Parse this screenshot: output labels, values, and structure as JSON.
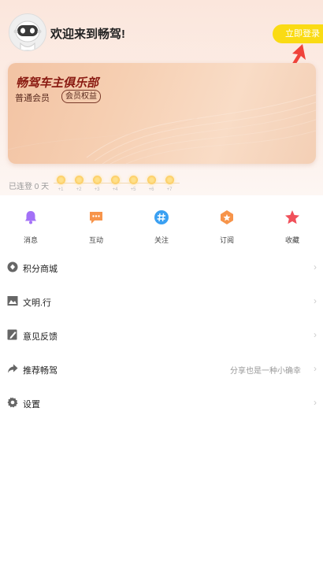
{
  "header": {
    "welcome_text": "欢迎来到畅驾!",
    "login_button": "立即登录",
    "avatar_icon": "robot-avatar-icon"
  },
  "member_card": {
    "title": "畅驾车主俱乐部",
    "level": "普通会员",
    "benefits_label": "会员权益"
  },
  "checkin": {
    "status": "已连登 0 天",
    "days": [
      "+1",
      "+2",
      "+3",
      "+4",
      "+5",
      "+6",
      "+7"
    ]
  },
  "quick_actions": [
    {
      "label": "消息",
      "icon": "bell-icon",
      "color": "#a371f7"
    },
    {
      "label": "互动",
      "icon": "chat-icon",
      "color": "#f7944a"
    },
    {
      "label": "关注",
      "icon": "hash-icon",
      "color": "#3aa0f2"
    },
    {
      "label": "订阅",
      "icon": "subscribe-icon",
      "color": "#f7944a"
    },
    {
      "label": "收藏",
      "icon": "star-icon",
      "color": "#f0505a"
    }
  ],
  "menu": [
    {
      "label": "积分商城",
      "hint": "",
      "icon": "points-mall-icon"
    },
    {
      "label": "文明.行",
      "hint": "",
      "icon": "image-icon"
    },
    {
      "label": "意见反馈",
      "hint": "",
      "icon": "feedback-edit-icon"
    },
    {
      "label": "推荐畅驾",
      "hint": "分享也是一种小确幸",
      "icon": "share-icon"
    },
    {
      "label": "设置",
      "hint": "",
      "icon": "gear-icon"
    }
  ]
}
